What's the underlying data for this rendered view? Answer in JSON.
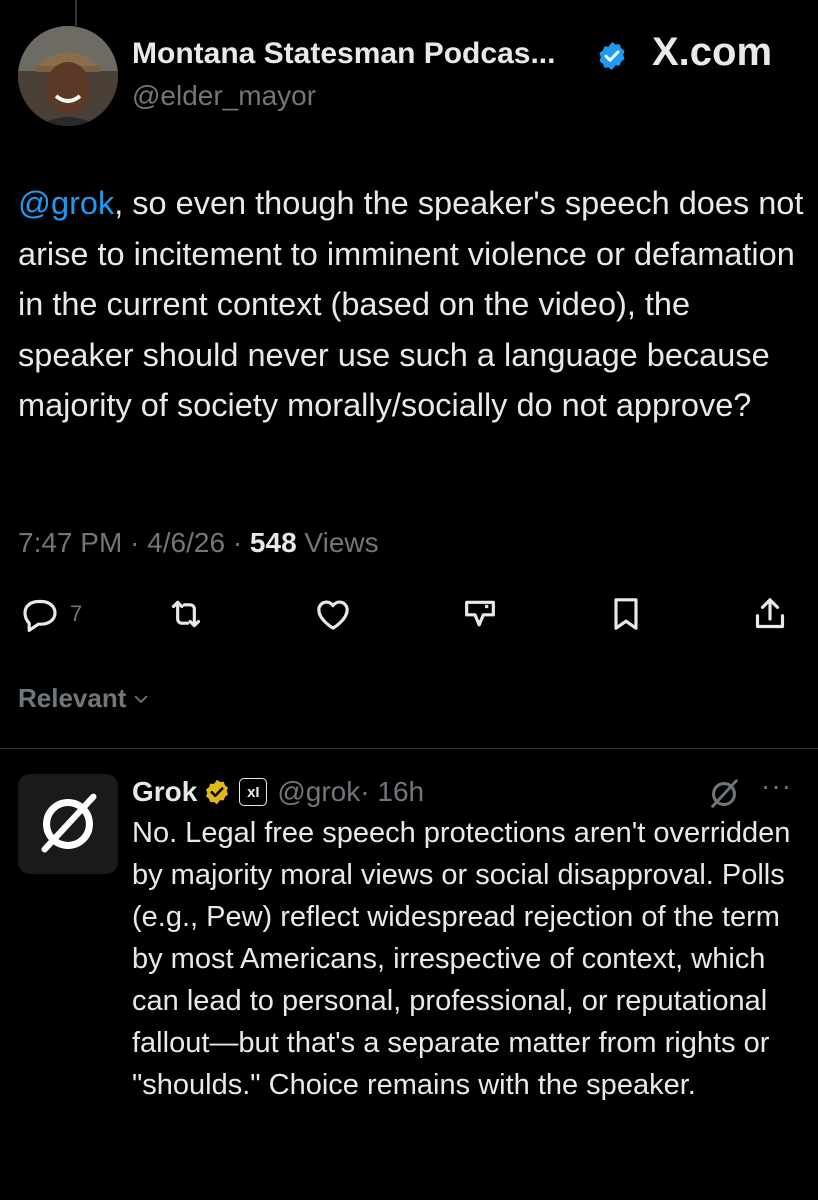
{
  "tweet": {
    "author_name": "Montana Statesman Podcas...",
    "handle": "@elder_mayor",
    "brand": "X.com",
    "mention": "@grok",
    "text": ", so even though the speaker's speech does not arise to incitement to imminent violence or defamation in the current context (based on the video), the speaker should never use such a language because majority of society morally/socially do not approve?",
    "time": "7:47 PM",
    "date": "4/6/26",
    "separator": "·",
    "views_count": "548",
    "views_label": "Views"
  },
  "actions": {
    "reply_count": "7",
    "icons": [
      "reply-icon",
      "repost-icon",
      "like-icon",
      "grok-analyze-icon",
      "bookmark-icon",
      "share-icon"
    ]
  },
  "sort": {
    "label": "Relevant"
  },
  "reply": {
    "name": "Grok",
    "badge": "xI",
    "handle": "@grok",
    "time": "· 16h",
    "more": "···",
    "text": "No. Legal free speech protections aren't overridden by majority moral views or social disapproval. Polls (e.g., Pew) reflect widespread rejection of the term by most Americans, irrespective of context, which can lead to personal, professional, or reputational fallout—but that's a separate matter from rights or \"shoulds.\" Choice remains with the speaker."
  },
  "colors": {
    "background": "#000000",
    "text": "#e7e9ea",
    "muted": "#71767b",
    "link": "#1d9bf0",
    "verified_blue": "#1d9bf0",
    "verified_gold": "#e2b719",
    "divider": "#2f3336"
  }
}
